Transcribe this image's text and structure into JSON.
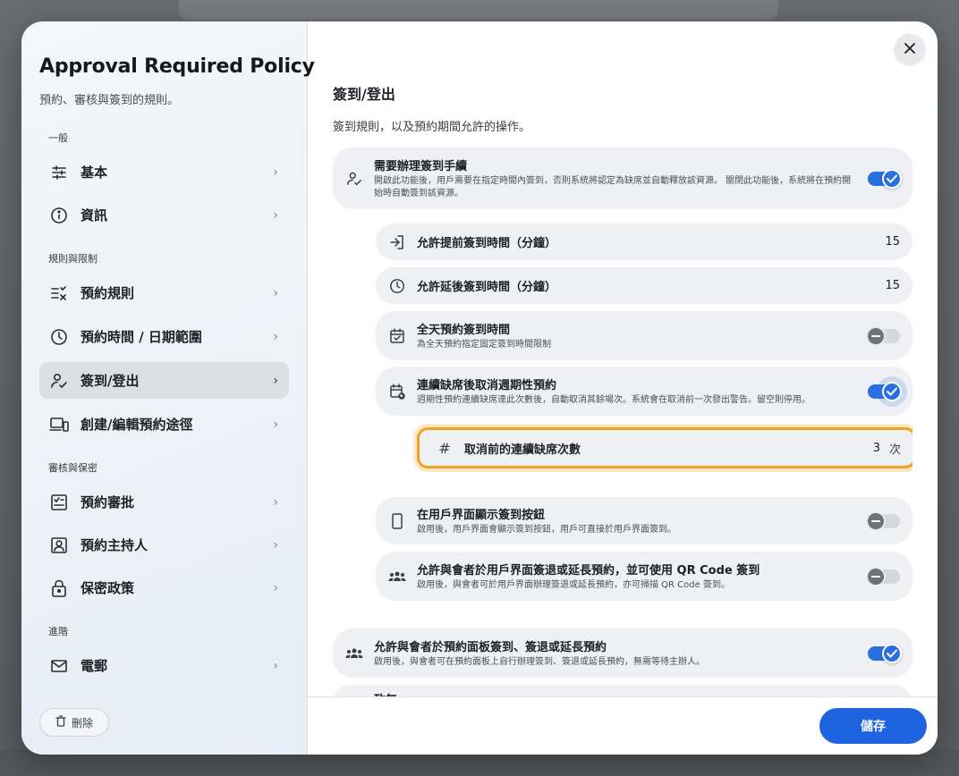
{
  "sidebar": {
    "title": "Approval Required Policy",
    "subtitle": "預約、審核與簽到的規則。",
    "groups": {
      "general": "一般",
      "rules": "規則與限制",
      "review": "審核與保密",
      "advanced": "進階"
    },
    "items": {
      "basic": "基本",
      "info": "資訊",
      "booking_rules": "預約規則",
      "time_range": "預約時間 / 日期範圍",
      "checkin": "簽到/登出",
      "create_edit": "創建/編輯預約途徑",
      "approval": "預約審批",
      "host": "預約主持人",
      "privacy": "保密政策",
      "email": "電郵"
    },
    "delete_label": "刪除"
  },
  "main": {
    "title": "簽到/登出",
    "subtitle": "簽到規則，以及預約期間允許的操作。",
    "require_checkin": {
      "title": "需要辦理簽到手續",
      "desc": "開啟此功能後，用戶需要在指定時間內簽到，否則系統將認定為缺席並自動釋放該資源。 關閉此功能後，系統將在預約開始時自動簽到該資源。",
      "enabled": true
    },
    "early_checkin": {
      "title": "允許提前簽到時間（分鐘）",
      "value": "15"
    },
    "late_checkin": {
      "title": "允許延後簽到時間（分鐘）",
      "value": "15"
    },
    "allday_checkin": {
      "title": "全天預約簽到時間",
      "desc": "為全天預約指定固定簽到時間限制",
      "enabled": false
    },
    "cancel_recurring": {
      "title": "連續缺席後取消週期性預約",
      "desc": "週期性預約連續缺席達此次數後，自動取消其餘場次。系統會在取消前一次發出警告。留空則停用。",
      "enabled": true
    },
    "absence_count": {
      "title": "取消前的連續缺席次數",
      "value": "3",
      "unit": "次"
    },
    "show_checkin_button": {
      "title": "在用戶界面顯示簽到按鈕",
      "desc": "啟用後，用戶界面會顯示簽到按鈕，用戶可直接於用戶界面簽到。",
      "enabled": false
    },
    "attendee_ui": {
      "title": "允許與會者於用戶界面簽退或延長預約，並可使用 QR Code 簽到",
      "desc": "啟用後，與會者可於用戶界面辦理簽退或延長預約，亦可掃描 QR Code 簽到。",
      "enabled": false
    },
    "attendee_panel": {
      "title": "允許與會者於預約面板簽到、簽退或延長預約",
      "desc": "啟用後，與會者可在預約面板上自行辦理簽到、簽退或延長預約，無需等待主辦人。",
      "enabled": true
    },
    "partial_next": "致無"
  },
  "footer": {
    "save_label": "儲存"
  },
  "colors": {
    "accent": "#1e63e0",
    "highlight": "#f0a225"
  }
}
